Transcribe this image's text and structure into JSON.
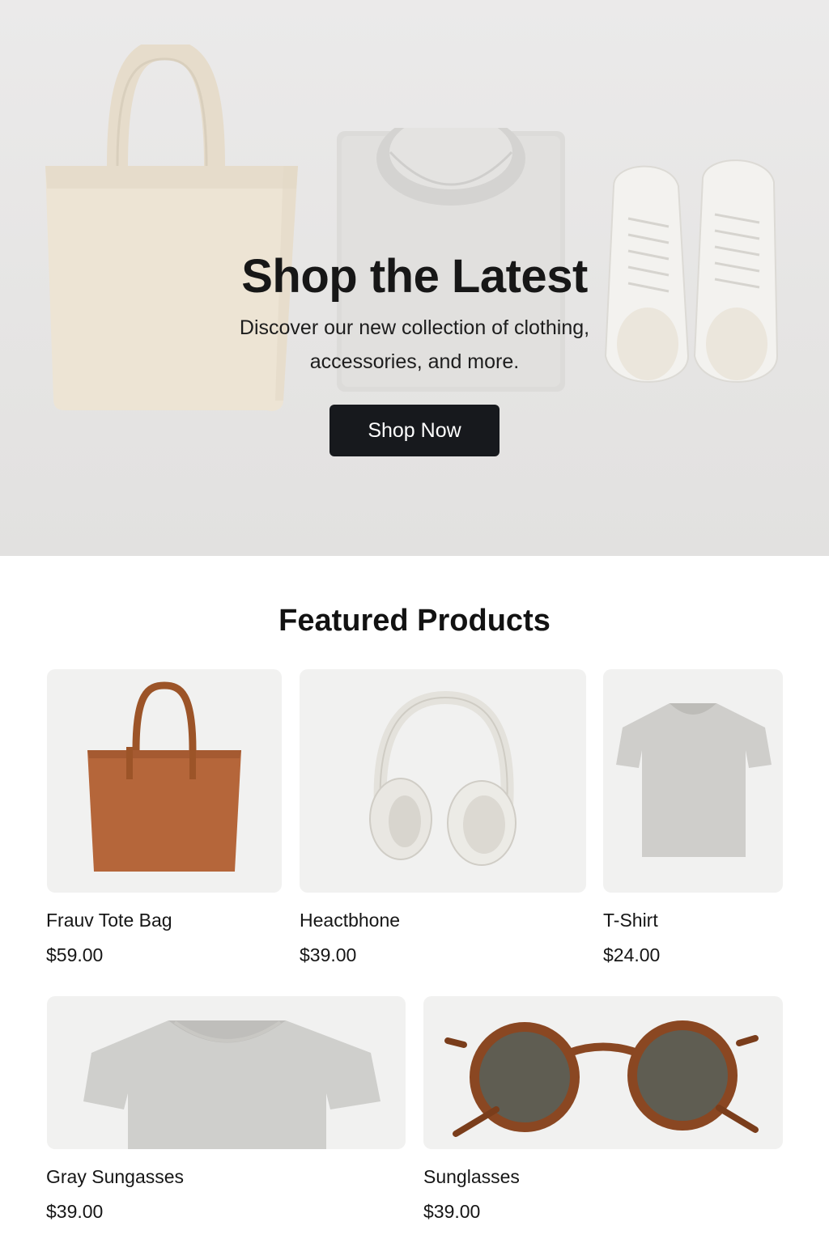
{
  "hero": {
    "title": "Shop the Latest",
    "subtitle": "Discover our new collection of clothing, accessories, and more.",
    "cta_label": "Shop Now"
  },
  "featured": {
    "title": "Featured Products",
    "products": [
      {
        "name": "Frauv Tote Bag",
        "price": "$59.00",
        "image": "brown-leather-tote-image"
      },
      {
        "name": "Heactbhone",
        "price": "$39.00",
        "image": "white-headphones-image"
      },
      {
        "name": "T-Shirt",
        "price": "$24.00",
        "image": "gray-tshirt-image"
      },
      {
        "name": "Gray Sungasses",
        "price": "$39.00",
        "image": "gray-tshirt-closeup-image"
      },
      {
        "name": "Sunglasses",
        "price": "$39.00",
        "image": "tortoise-sunglasses-image"
      }
    ]
  },
  "colors": {
    "button_bg": "#17191d",
    "button_text": "#ffffff",
    "card_bg": "#f1f1f0",
    "hero_bg": "#e6e5e4"
  }
}
